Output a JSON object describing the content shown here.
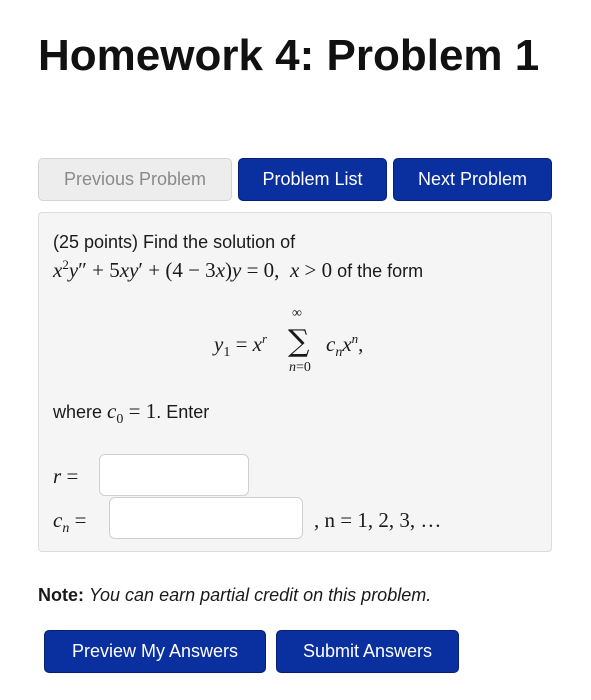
{
  "title": "Homework 4: Problem 1",
  "nav": {
    "previous": "Previous Problem",
    "list": "Problem List",
    "next": "Next Problem"
  },
  "problem": {
    "intro": "(25 points) Find the solution of",
    "equation_suffix": "of the form",
    "where_prefix": "where",
    "where_suffix": ". Enter",
    "r_label": "r =",
    "cn_range": ", n = 1, 2, 3, …",
    "r_value": "",
    "cn_value": ""
  },
  "note": {
    "label": "Note:",
    "text": "You can earn partial credit on this problem."
  },
  "actions": {
    "preview": "Preview My Answers",
    "submit": "Submit Answers"
  },
  "colors": {
    "primary_button": "#0a2f9e",
    "disabled_button": "#ededed",
    "panel_background": "#f5f5f5"
  }
}
